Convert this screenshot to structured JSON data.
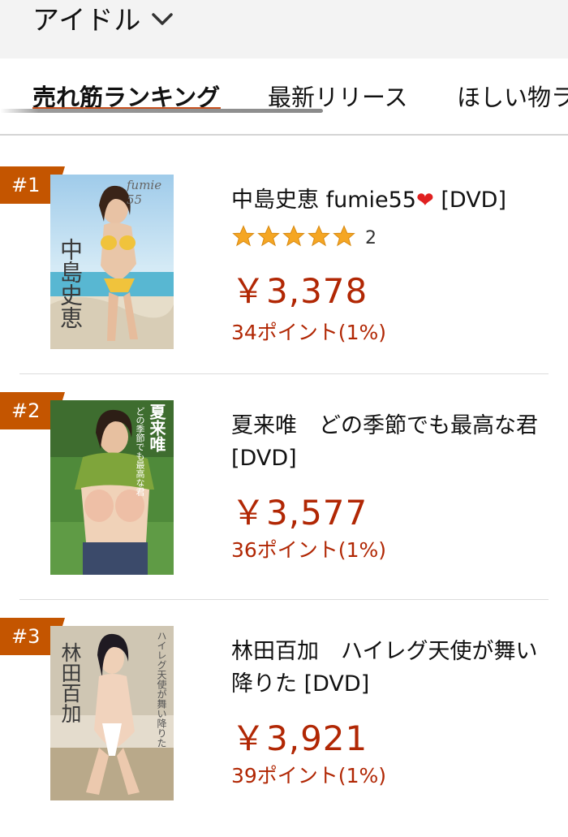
{
  "header": {
    "category_label": "アイドル",
    "icon": "chevron-down-icon"
  },
  "tabs": [
    {
      "label": "売れ筋ランキング",
      "active": true
    },
    {
      "label": "最新リリース",
      "active": false
    },
    {
      "label": "ほしい物ラ",
      "active": false
    }
  ],
  "products": [
    {
      "rank": "#1",
      "title": "中島史恵 fumie55",
      "title_suffix": " [DVD]",
      "rating_stars": 5,
      "review_count": "2",
      "price": "￥3,378",
      "points": "34ポイント(1%)",
      "cover_text": {
        "main": "中島史恵",
        "sub": "fumie 55"
      }
    },
    {
      "rank": "#2",
      "title": "夏来唯　どの季節でも最高な君 [DVD]",
      "price": "￥3,577",
      "points": "36ポイント(1%)",
      "cover_text": {
        "main": "夏来唯",
        "sub": "どの季節でも最高な君"
      }
    },
    {
      "rank": "#3",
      "title": "林田百加　ハイレグ天使が舞い降りた [DVD]",
      "price": "￥3,921",
      "points": "39ポイント(1%)",
      "cover_text": {
        "main": "林田百加",
        "sub": "ハイレグ天使が舞い降りた"
      }
    }
  ],
  "colors": {
    "accent": "#c45500",
    "price": "#b12704",
    "star": "#f5a623"
  }
}
